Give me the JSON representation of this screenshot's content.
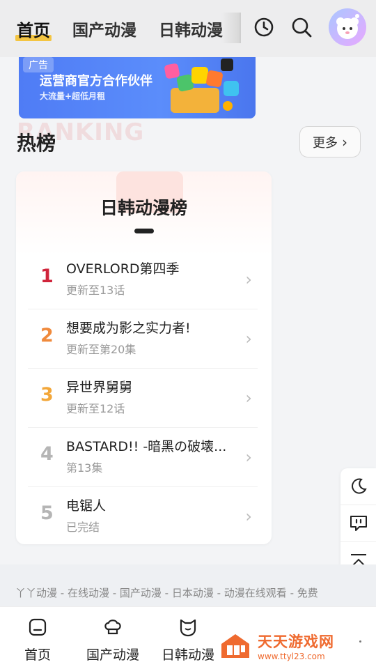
{
  "header": {
    "tabs": [
      {
        "label": "首页",
        "active": true
      },
      {
        "label": "国产动漫",
        "active": false
      },
      {
        "label": "日韩动漫",
        "active": false
      }
    ],
    "icons": [
      "history-icon",
      "search-icon",
      "avatar"
    ]
  },
  "ad": {
    "badge": "广告",
    "title": "运营商官方合作伙伴",
    "subtitle": "大流量+超低月租"
  },
  "hot": {
    "background_word": "RANKING",
    "title": "热榜",
    "more_label": "更多"
  },
  "ranking": {
    "title": "日韩动漫榜",
    "items": [
      {
        "rank": "1",
        "name": "OVERLORD第四季",
        "status": "更新至13话",
        "color": "#d0243b"
      },
      {
        "rank": "2",
        "name": "想要成为影之实力者!",
        "status": "更新至第20集",
        "color": "#f08a3c"
      },
      {
        "rank": "3",
        "name": "异世界舅舅",
        "status": "更新至12话",
        "color": "#f3a73a"
      },
      {
        "rank": "4",
        "name": "BASTARD!! -暗黑の破壊...",
        "status": "第13集",
        "color": "#b5b5b5"
      },
      {
        "rank": "5",
        "name": "电锯人",
        "status": "已完结",
        "color": "#b5b5b5"
      }
    ]
  },
  "float_tools": [
    "dark-mode-icon",
    "feedback-icon",
    "back-to-top-icon"
  ],
  "footer": {
    "links": "丫丫动漫 - 在线动漫 - 国产动漫 - 日本动漫 - 动漫在线观看 - 免费"
  },
  "bottom_nav": [
    {
      "label": "首页",
      "icon": "home-icon"
    },
    {
      "label": "国产动漫",
      "icon": "chef-hat-icon"
    },
    {
      "label": "日韩动漫",
      "icon": "cat-icon"
    }
  ],
  "watermark": {
    "title": "天天游戏网",
    "url": "www.ttyl23.com"
  }
}
